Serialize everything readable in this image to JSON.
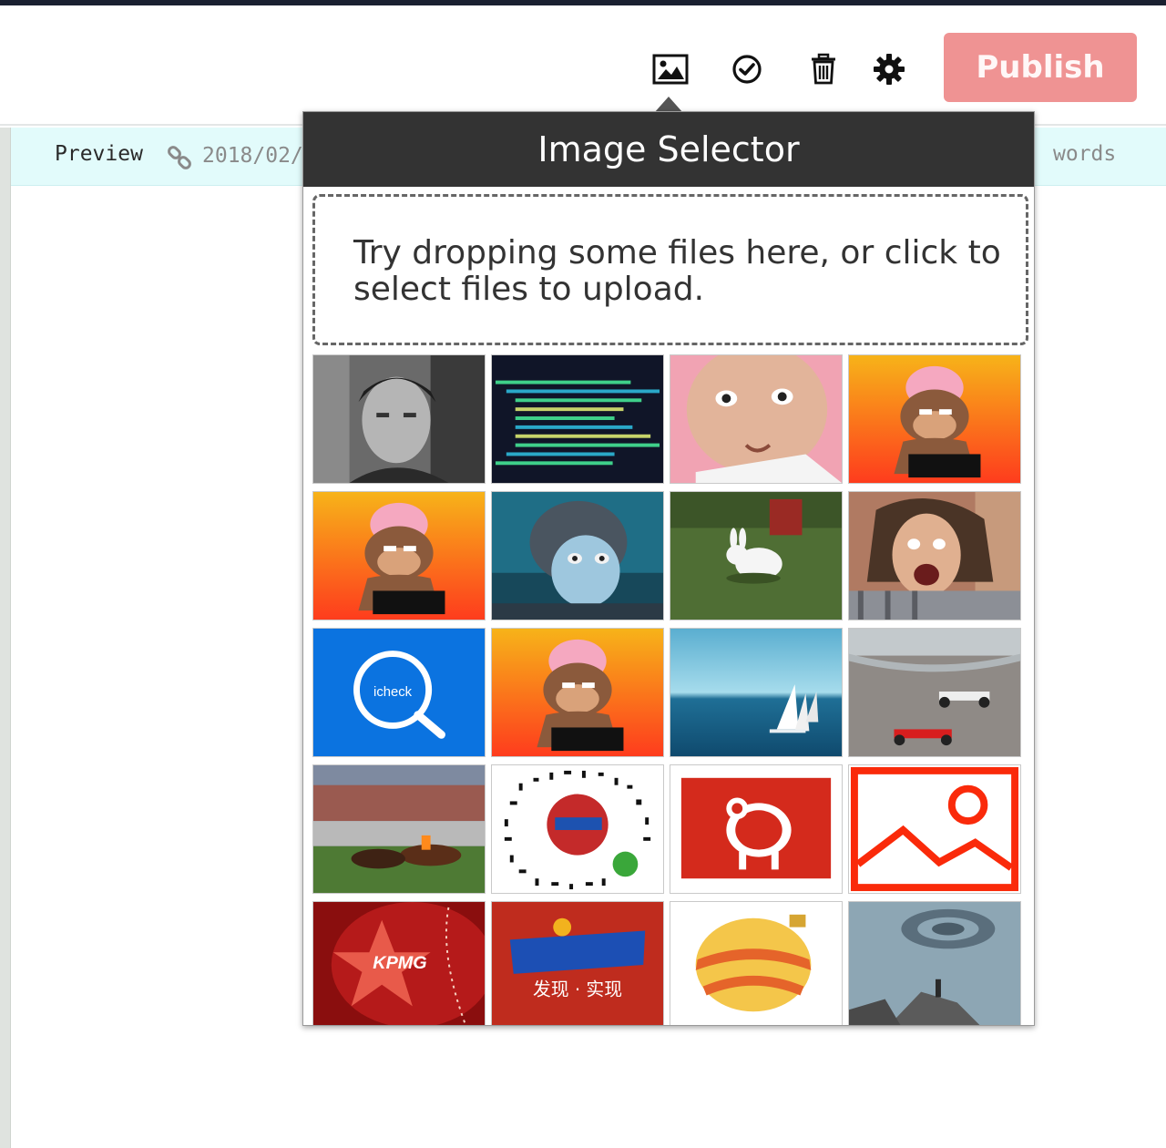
{
  "toolbar": {
    "icons": [
      "image-icon",
      "check-circle-icon",
      "trash-icon",
      "gear-icon"
    ],
    "publish_label": "Publish",
    "publish_color": "#ef9393"
  },
  "infobar": {
    "preview_label": "Preview",
    "link_text": "2018/02/",
    "words_label": "words",
    "background": "#e2fbfb"
  },
  "popup": {
    "title": "Image Selector",
    "dropzone_text": "Try dropping some files here, or click to select files to upload.",
    "thumbnails": [
      {
        "name": "bw-portrait-man-train",
        "label": ""
      },
      {
        "name": "code-screenshot",
        "label": ""
      },
      {
        "name": "face-pink-background",
        "label": ""
      },
      {
        "name": "brain-monkey-laptop",
        "label": ""
      },
      {
        "name": "brain-monkey-laptop",
        "label": ""
      },
      {
        "name": "monkey-king-animation",
        "label": ""
      },
      {
        "name": "rabbit-on-grass",
        "label": ""
      },
      {
        "name": "shouting-man",
        "label": ""
      },
      {
        "name": "icheck-logo",
        "label": "icheck"
      },
      {
        "name": "brain-monkey-laptop",
        "label": ""
      },
      {
        "name": "sailboats-sea",
        "label": ""
      },
      {
        "name": "f1-race-cars",
        "label": ""
      },
      {
        "name": "horse-race",
        "label": ""
      },
      {
        "name": "stralive-qr-code",
        "label": ""
      },
      {
        "name": "papercut-sheep",
        "label": ""
      },
      {
        "name": "image-placeholder",
        "label": ""
      },
      {
        "name": "kpmg-star",
        "label": "KPMG"
      },
      {
        "name": "stralive-logo",
        "label": "发现 · 实现"
      },
      {
        "name": "christmas-ornament",
        "label": ""
      },
      {
        "name": "fantasy-tornado",
        "label": ""
      }
    ]
  }
}
